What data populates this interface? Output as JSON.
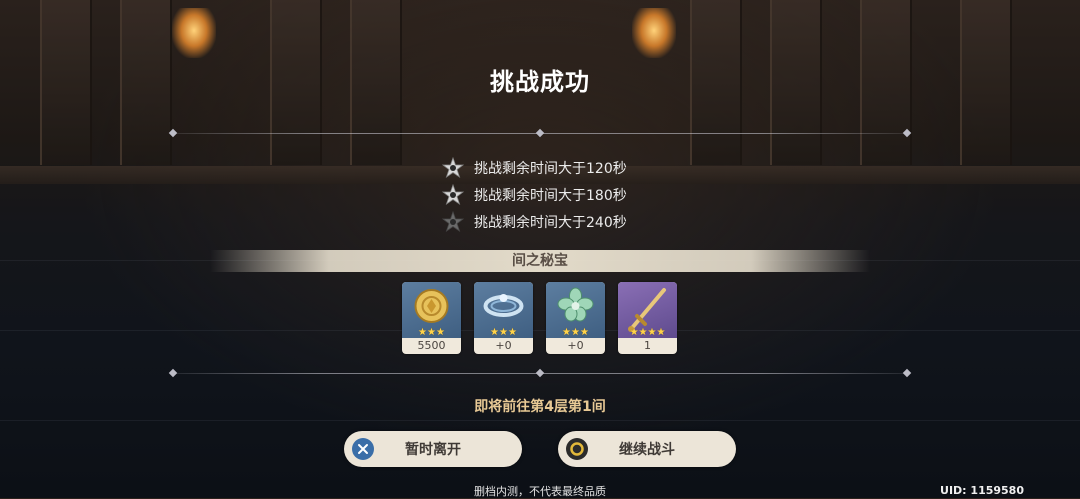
{
  "title": "挑战成功",
  "conditions": [
    {
      "text": "挑战剩余时间大于120秒",
      "achieved": true
    },
    {
      "text": "挑战剩余时间大于180秒",
      "achieved": true
    },
    {
      "text": "挑战剩余时间大于240秒",
      "achieved": false
    }
  ],
  "reward_title": "间之秘宝",
  "rewards": [
    {
      "icon": "mora-coin-icon",
      "stars": "★★★",
      "count": "5500"
    },
    {
      "icon": "artifact-circlet-icon",
      "stars": "★★★",
      "count": "+0"
    },
    {
      "icon": "artifact-flower-icon",
      "stars": "★★★",
      "count": "+0"
    },
    {
      "icon": "weapon-sword-icon",
      "stars": "★★★★",
      "count": "1"
    }
  ],
  "next_floor": "即将前往第4层第1间",
  "buttons": {
    "leave": "暂时离开",
    "continue": "继续战斗"
  },
  "footer": "删档内测，不代表最终品质",
  "uid": "UID: 1159580",
  "colors": {
    "accent_gold": "#e8c995",
    "star_yellow": "#ffd34a",
    "button_bg": "#ece5d8",
    "leave_icon": "#3a6ea8",
    "continue_icon": "#e2b83a"
  }
}
